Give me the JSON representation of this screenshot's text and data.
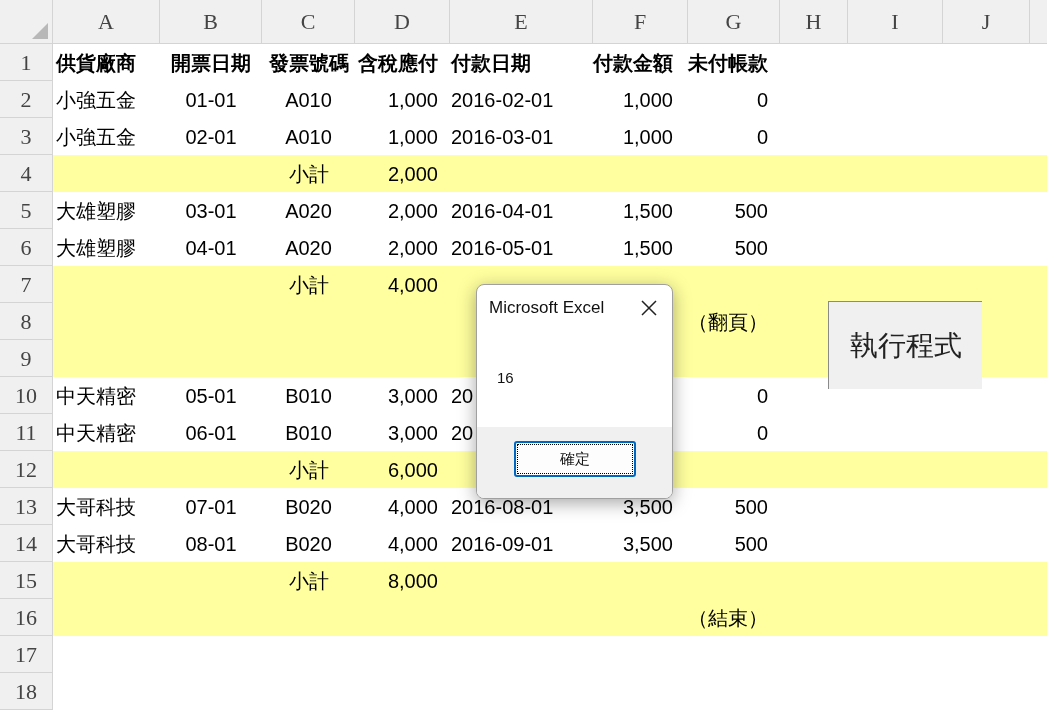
{
  "columns": [
    "A",
    "B",
    "C",
    "D",
    "E",
    "F",
    "G",
    "H",
    "I",
    "J"
  ],
  "title_row": {
    "number": "1",
    "cells": {
      "A": "供貨廠商",
      "B": "開票日期",
      "C": "發票號碼",
      "D": "含稅應付",
      "E": "付款日期",
      "F": "付款金額",
      "G": "未付帳款"
    }
  },
  "rows": [
    {
      "number": "2",
      "highlighted": false,
      "cells": {
        "A": "小強五金",
        "B": "01-01",
        "C": "A010",
        "D": "1,000",
        "E": "2016-02-01",
        "F": "1,000",
        "G": "0"
      }
    },
    {
      "number": "3",
      "highlighted": false,
      "cells": {
        "A": "小強五金",
        "B": "02-01",
        "C": "A010",
        "D": "1,000",
        "E": "2016-03-01",
        "F": "1,000",
        "G": "0"
      }
    },
    {
      "number": "4",
      "highlighted": true,
      "cells": {
        "C": "小計",
        "D": "2,000"
      }
    },
    {
      "number": "5",
      "highlighted": false,
      "cells": {
        "A": "大雄塑膠",
        "B": "03-01",
        "C": "A020",
        "D": "2,000",
        "E": "2016-04-01",
        "F": "1,500",
        "G": "500"
      }
    },
    {
      "number": "6",
      "highlighted": false,
      "cells": {
        "A": "大雄塑膠",
        "B": "04-01",
        "C": "A020",
        "D": "2,000",
        "E": "2016-05-01",
        "F": "1,500",
        "G": "500"
      }
    },
    {
      "number": "7",
      "highlighted": true,
      "cells": {
        "C": "小計",
        "D": "4,000"
      }
    },
    {
      "number": "8",
      "highlighted": true,
      "cells": {
        "G": "（翻頁）"
      }
    },
    {
      "number": "9",
      "highlighted": true
    },
    {
      "number": "10",
      "highlighted": false,
      "cells": {
        "A": "中天精密",
        "B": "05-01",
        "C": "B010",
        "D": "3,000",
        "E": "20",
        "G": "0"
      }
    },
    {
      "number": "11",
      "highlighted": false,
      "cells": {
        "A": "中天精密",
        "B": "06-01",
        "C": "B010",
        "D": "3,000",
        "E": "20",
        "G": "0"
      }
    },
    {
      "number": "12",
      "highlighted": true,
      "cells": {
        "C": "小計",
        "D": "6,000"
      }
    },
    {
      "number": "13",
      "highlighted": false,
      "cells": {
        "A": "大哥科技",
        "B": "07-01",
        "C": "B020",
        "D": "4,000",
        "E": "2016-08-01",
        "F": "3,500",
        "G": "500"
      }
    },
    {
      "number": "14",
      "highlighted": false,
      "cells": {
        "A": "大哥科技",
        "B": "08-01",
        "C": "B020",
        "D": "4,000",
        "E": "2016-09-01",
        "F": "3,500",
        "G": "500"
      }
    },
    {
      "number": "15",
      "highlighted": true,
      "cells": {
        "C": "小計",
        "D": "8,000"
      }
    },
    {
      "number": "16",
      "highlighted": true,
      "cells": {
        "G": "（結束）"
      }
    },
    {
      "number": "17",
      "highlighted": false
    },
    {
      "number": "18",
      "highlighted": false
    }
  ],
  "macro_button": {
    "label": "執行程式"
  },
  "dialog": {
    "title": "Microsoft Excel",
    "message": "16",
    "button": "確定"
  }
}
